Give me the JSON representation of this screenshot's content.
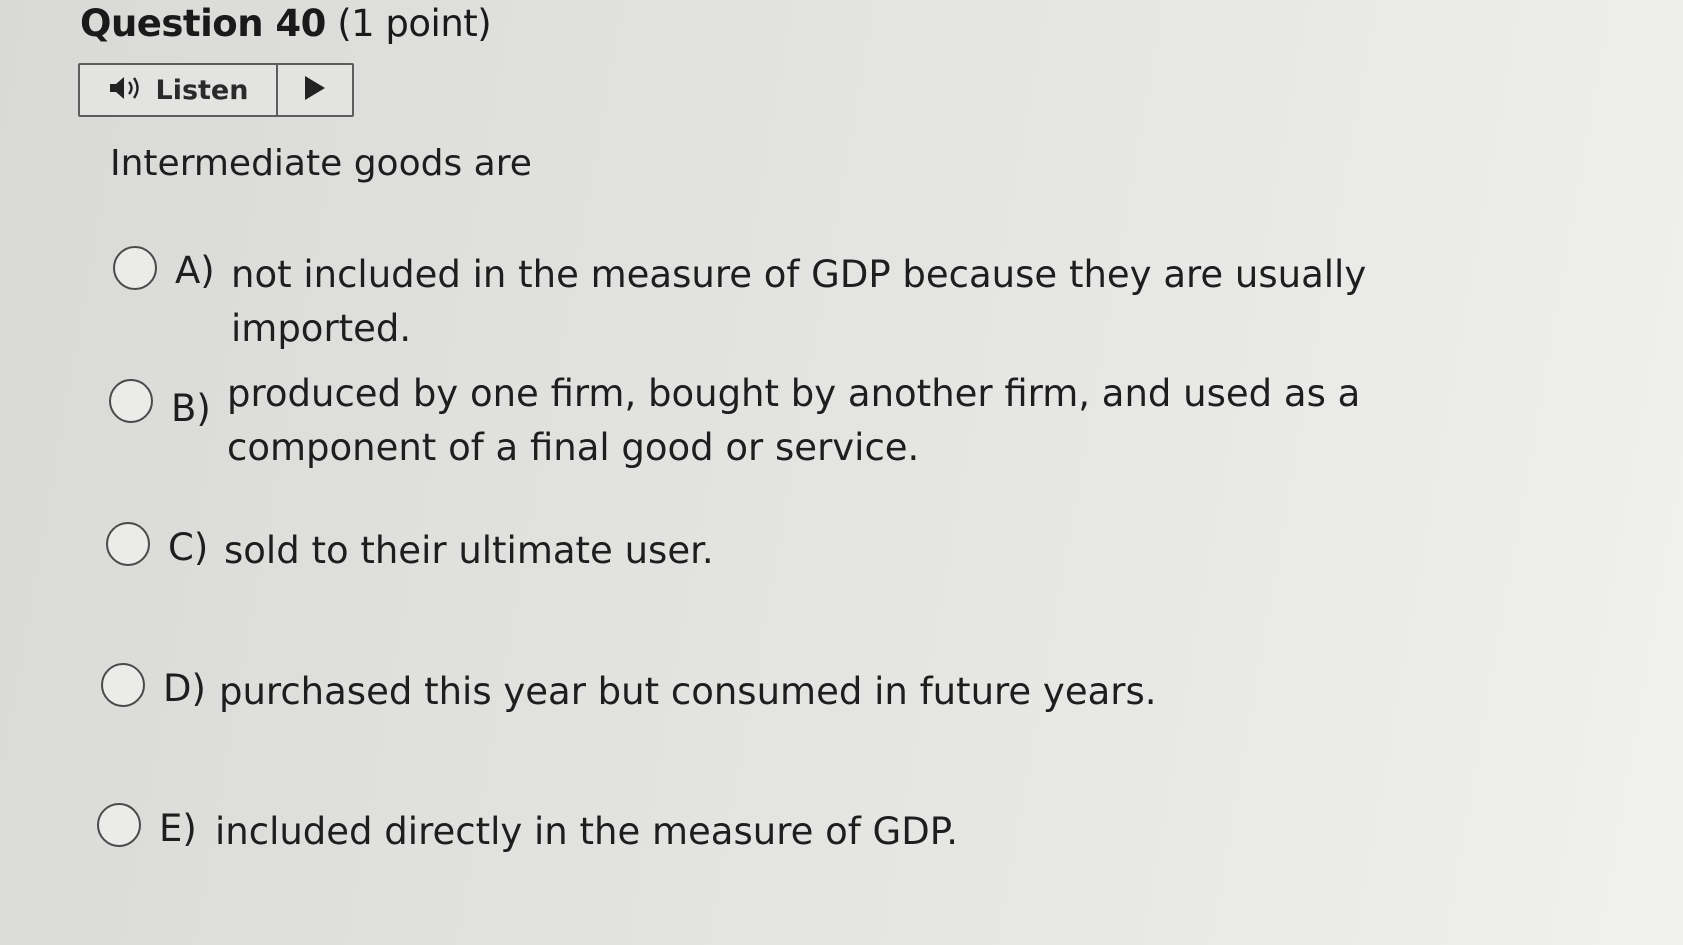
{
  "question": {
    "number_label": "Question 40",
    "points_label": "(1 point)"
  },
  "listen": {
    "label": "Listen",
    "speaker_icon": "speaker-icon",
    "play_icon": "play-icon"
  },
  "stem": "Intermediate goods are",
  "options": [
    {
      "letter": "A)",
      "text": "not included in the measure of GDP because they are usually imported."
    },
    {
      "letter": "B)",
      "text": "produced by one firm, bought by another firm, and used as a component of a final good or service."
    },
    {
      "letter": "C)",
      "text": "sold to their ultimate user."
    },
    {
      "letter": "D)",
      "text": "purchased this year but consumed in future years."
    },
    {
      "letter": "E)",
      "text": "included directly in the measure of GDP."
    }
  ]
}
